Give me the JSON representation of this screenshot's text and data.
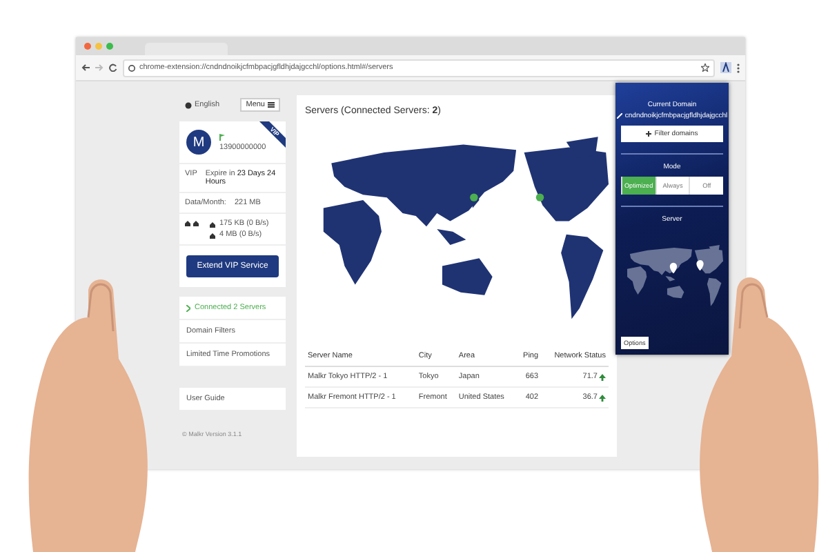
{
  "browser": {
    "address": "chrome-extension://cndndnoikjcfmbpacjgfldhjdajgcchl/options.html#/servers"
  },
  "sidebar": {
    "language": "English",
    "menu_button": "Menu",
    "vip_ribbon": "VIP",
    "avatar_letter": "M",
    "phone": "13900000000",
    "vip_label": "VIP",
    "expires": "Expire in **23 Days 24 Hours**",
    "data_label": "Data/Month:",
    "data_value": "221 MB",
    "traffic": [
      {
        "text": "175 KB (0 B/s)"
      },
      {
        "text": "4 MB (0 B/s)"
      }
    ],
    "extend_button": "Extend VIP Service",
    "nav": [
      {
        "label": "Connected 2 Servers",
        "selected": true
      },
      {
        "label": "Domain Filters",
        "selected": false
      },
      {
        "label": "Limited Time Promotions",
        "selected": false
      }
    ],
    "user_guide": "User Guide",
    "version": "© Malkr Version 3.1.1"
  },
  "servers": {
    "title": "Servers (Connected Servers: **2**)",
    "columns": [
      "Server Name",
      "City",
      "Area",
      "Ping",
      "Network Status"
    ],
    "rows": [
      {
        "cells": [
          "Malkr Tokyo HTTP/2 - 1",
          "Tokyo",
          "Japan",
          "663",
          "71.7"
        ]
      },
      {
        "cells": [
          "Malkr Fremont HTTP/2 - 1",
          "Fremont",
          "United States",
          "402",
          "36.7"
        ]
      }
    ]
  },
  "popup": {
    "heading": "Current Domain",
    "domain": "cndndnoikjcfmbpacjgfldhjdajgcchl",
    "filter_button": "Filter domains",
    "mode_label": "Mode",
    "modes": [
      {
        "label": "Optimized",
        "selected": true
      },
      {
        "label": "Always",
        "selected": false
      },
      {
        "label": "Off",
        "selected": false
      }
    ],
    "server_label": "Server",
    "options_button": "Options"
  }
}
